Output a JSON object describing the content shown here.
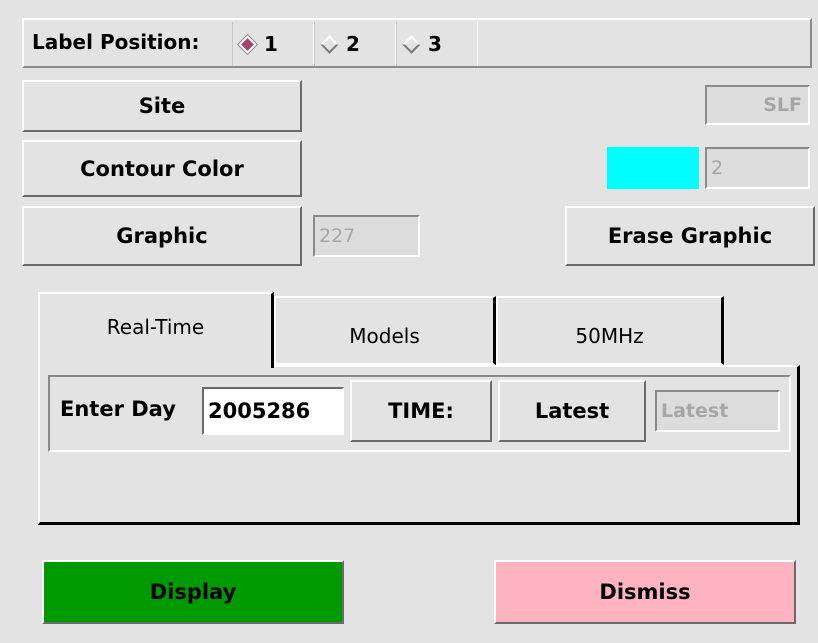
{
  "label_position": {
    "label": "Label Position:",
    "options": [
      "1",
      "2",
      "3"
    ],
    "selected": "1"
  },
  "site": {
    "button": "Site",
    "value": "SLF"
  },
  "contour": {
    "button": "Contour Color",
    "value": "2",
    "swatch_color": "#00ffff"
  },
  "graphic": {
    "button": "Graphic",
    "value": "227",
    "erase_button": "Erase Graphic"
  },
  "tabs": [
    "Real-Time",
    "Models",
    "50MHz"
  ],
  "active_tab": "Real-Time",
  "realtime": {
    "enter_day_label": "Enter Day",
    "enter_day_value": "2005286",
    "time_button": "TIME:",
    "latest_button": "Latest",
    "latest_field": "Latest"
  },
  "actions": {
    "display": "Display",
    "dismiss": "Dismiss"
  },
  "colors": {
    "display": "#009a00",
    "dismiss": "#ffb3c1",
    "selected_radio": "#a8436a"
  }
}
